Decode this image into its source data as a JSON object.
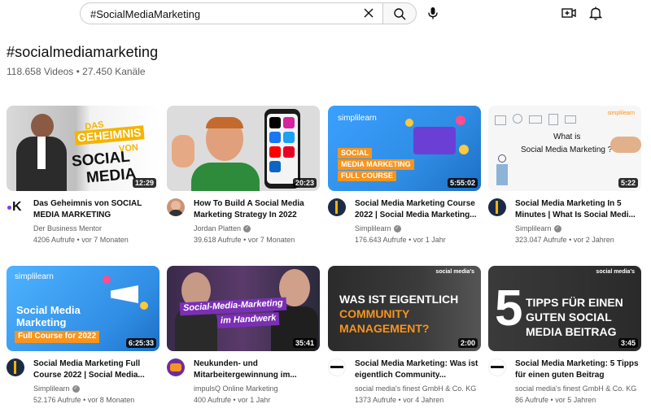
{
  "search": {
    "query": "#SocialMediaMarketing"
  },
  "hashtag": {
    "title": "#socialmediamarketing",
    "stats": "118.658 Videos • 27.450 Kanäle"
  },
  "icons": {
    "clear": "close-icon",
    "search": "search-icon",
    "mic": "microphone-icon",
    "create": "video-add-icon",
    "notifications": "bell-icon"
  },
  "videos": [
    {
      "title": "Das Geheimnis von SOCIAL MEDIA MARKETING",
      "channel": "Der Business Mentor",
      "verified": false,
      "views": "4206 Aufrufe",
      "age": "vor 7 Monaten",
      "duration": "12:29",
      "thumb_text": [
        "DAS",
        "GEHEIMNIS",
        "VON",
        "SOCIAL",
        "MEDIA"
      ],
      "avatar_letter": "K"
    },
    {
      "title": "How To Build A Social Media Marketing Strategy In 2022",
      "channel": "Jordan Platten",
      "verified": true,
      "views": "39.618 Aufrufe",
      "age": "vor 7 Monaten",
      "duration": "20:23"
    },
    {
      "title": "Social Media Marketing Course 2022 | Social Media Marketing...",
      "channel": "Simplilearn",
      "verified": true,
      "views": "176.643 Aufrufe",
      "age": "vor 1 Jahr",
      "duration": "5:55:02",
      "thumb_text": [
        "SOCIAL",
        "MEDIA MARKETING",
        "FULL COURSE"
      ],
      "thumb_brand": "simplilearn"
    },
    {
      "title": "Social Media Marketing In 5 Minutes | What Is Social Medi...",
      "channel": "Simplilearn",
      "verified": true,
      "views": "323.047 Aufrufe",
      "age": "vor 2 Jahren",
      "duration": "5:22",
      "thumb_text": [
        "What is",
        "Social Media Marketing ?"
      ],
      "thumb_brand": "simplilearn"
    },
    {
      "title": "Social Media Marketing Full Course 2022 | Social Media...",
      "channel": "Simplilearn",
      "verified": true,
      "views": "52.176 Aufrufe",
      "age": "vor 8 Monaten",
      "duration": "6:25:33",
      "thumb_text": [
        "Social Media",
        "Marketing",
        "Full Course for 2022"
      ],
      "thumb_brand": "simplilearn"
    },
    {
      "title": "Neukunden- und Mitarbeitergewinnung im...",
      "channel": "impulsQ Online Marketing",
      "verified": false,
      "views": "400 Aufrufe",
      "age": "vor 1 Jahr",
      "duration": "35:41",
      "thumb_text": [
        "Social-Media-Marketing",
        "im Handwerk"
      ]
    },
    {
      "title": "Social Media Marketing: Was ist eigentlich Community...",
      "channel": "social media's finest GmbH & Co. KG",
      "verified": false,
      "views": "1373 Aufrufe",
      "age": "vor 4 Jahren",
      "duration": "2:00",
      "thumb_text": [
        "WAS IST EIGENTLICH",
        "COMMUNITY",
        "MANAGEMENT?"
      ],
      "thumb_brand": "social media's"
    },
    {
      "title": "Social Media Marketing: 5 Tipps für einen guten Beitrag",
      "channel": "social media's finest GmbH & Co. KG",
      "verified": false,
      "views": "86 Aufrufe",
      "age": "vor 5 Jahren",
      "duration": "3:45",
      "thumb_text": [
        "5",
        "TIPPS FÜR EINEN",
        "GUTEN SOCIAL",
        "MEDIA BEITRAG"
      ],
      "thumb_brand": "social media's"
    }
  ],
  "colors": {
    "accent": "#f4b400",
    "simplilearn_blue": "#2f8de4",
    "dark": "#2b2b2b",
    "orange": "#f7941d"
  }
}
